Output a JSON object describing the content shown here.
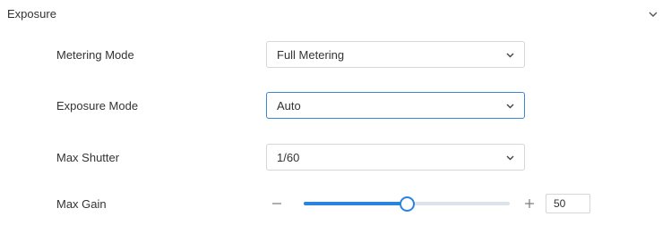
{
  "section": {
    "title": "Exposure",
    "chevron_icon": "chevron-down-icon"
  },
  "metering_mode": {
    "label": "Metering Mode",
    "value": "Full Metering",
    "icon": "chevron-down-icon"
  },
  "exposure_mode": {
    "label": "Exposure Mode",
    "value": "Auto",
    "icon": "chevron-down-icon"
  },
  "max_shutter": {
    "label": "Max Shutter",
    "value": "1/60",
    "icon": "chevron-down-icon"
  },
  "max_gain": {
    "label": "Max Gain",
    "value": "50",
    "min": 0,
    "max": 100,
    "minus_icon": "minus-icon",
    "plus_icon": "plus-icon"
  },
  "colors": {
    "accent": "#2c83dd",
    "border": "#d6d6d6",
    "track": "#dde3ea",
    "text": "#333333"
  }
}
